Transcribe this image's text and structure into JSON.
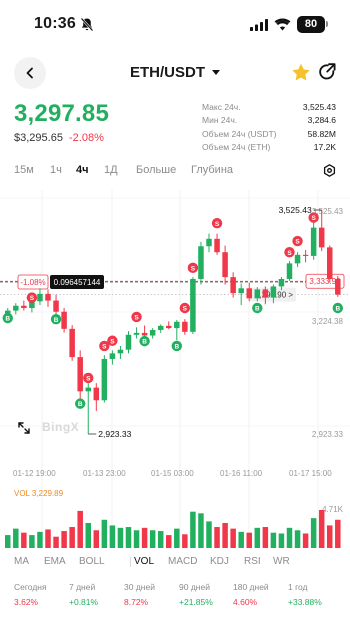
{
  "status_bar": {
    "time": "10:36",
    "battery": "80"
  },
  "header": {
    "pair": "ETH/USDT"
  },
  "ticker": {
    "last_price": "3,297.85",
    "fiat_price": "$3,295.65",
    "change_pct": "-2.08%",
    "stats": [
      {
        "label": "Макс 24ч.",
        "value": "3,525.43"
      },
      {
        "label": "Мин 24ч.",
        "value": "3,284.6"
      },
      {
        "label": "Объем 24ч (USDT)",
        "value": "58.82M"
      },
      {
        "label": "Объем 24ч (ETH)",
        "value": "17.2K"
      }
    ]
  },
  "timeframe_tabs": [
    "15м",
    "1ч",
    "4ч",
    "1Д",
    "Больше",
    "Глубина"
  ],
  "timeframe_selected": "4ч",
  "chart": {
    "watermark": "BingX",
    "high_marker": "3,525.43",
    "low_marker": "2,923.33",
    "axis_right_top": "3,525.43",
    "axis_right_mid": "3,224.38",
    "axis_right_bottom": "2,923.33",
    "last_price_tag": "3,333.93",
    "crosshair_pct": "-1.08%",
    "crosshair_value": "0.096457144",
    "mark_price_label": "3,297.90",
    "vol_label": "VOL 3,229.89",
    "vol_axis": "4.71K",
    "buy_badge": "B",
    "sell_badge": "S"
  },
  "chart_data": {
    "type": "candlestick",
    "x_ticks": [
      "01-12 19:00",
      "01-13 23:00",
      "01-15 03:00",
      "01-16 11:00",
      "01-17 15:00"
    ],
    "price_range": [
      2923.33,
      3525.43
    ],
    "price_ticks": [
      3525.43,
      3224.38,
      2923.33
    ],
    "candles": [
      [
        3245,
        3262,
        3232,
        3255
      ],
      [
        3255,
        3275,
        3245,
        3268
      ],
      [
        3268,
        3282,
        3255,
        3262
      ],
      [
        3262,
        3285,
        3250,
        3280
      ],
      [
        3280,
        3315,
        3270,
        3300
      ],
      [
        3300,
        3312,
        3265,
        3282
      ],
      [
        3282,
        3298,
        3240,
        3252
      ],
      [
        3252,
        3262,
        3196,
        3206
      ],
      [
        3206,
        3216,
        3120,
        3130
      ],
      [
        3130,
        3148,
        3012,
        3038
      ],
      [
        3038,
        3060,
        2923.33,
        3048
      ],
      [
        3048,
        3060,
        2985,
        3014
      ],
      [
        3014,
        3135,
        3008,
        3125
      ],
      [
        3125,
        3148,
        3110,
        3140
      ],
      [
        3140,
        3160,
        3125,
        3150
      ],
      [
        3150,
        3200,
        3140,
        3190
      ],
      [
        3190,
        3210,
        3180,
        3195
      ],
      [
        3195,
        3215,
        3182,
        3188
      ],
      [
        3188,
        3208,
        3180,
        3203
      ],
      [
        3203,
        3218,
        3195,
        3214
      ],
      [
        3214,
        3226,
        3205,
        3208
      ],
      [
        3208,
        3230,
        3175,
        3225
      ],
      [
        3225,
        3232,
        3190,
        3198
      ],
      [
        3198,
        3345,
        3192,
        3340
      ],
      [
        3340,
        3440,
        3325,
        3428
      ],
      [
        3428,
        3462,
        3412,
        3448
      ],
      [
        3448,
        3462,
        3405,
        3412
      ],
      [
        3412,
        3430,
        3325,
        3345
      ],
      [
        3345,
        3358,
        3290,
        3302
      ],
      [
        3302,
        3328,
        3270,
        3315
      ],
      [
        3315,
        3330,
        3280,
        3288
      ],
      [
        3288,
        3318,
        3280,
        3312
      ],
      [
        3312,
        3320,
        3272,
        3290
      ],
      [
        3290,
        3325,
        3275,
        3320
      ],
      [
        3320,
        3345,
        3310,
        3340
      ],
      [
        3340,
        3388,
        3335,
        3382
      ],
      [
        3382,
        3412,
        3372,
        3405
      ],
      [
        3405,
        3418,
        3385,
        3402
      ],
      [
        3402,
        3492,
        3392,
        3478
      ],
      [
        3478,
        3525.43,
        3415,
        3425
      ],
      [
        3425,
        3430,
        3330,
        3340
      ],
      [
        3340,
        3348,
        3292,
        3298
      ]
    ],
    "volume": [
      1.6,
      2.4,
      1.9,
      1.6,
      2.0,
      2.3,
      1.4,
      2.1,
      2.6,
      4.6,
      3.1,
      2.2,
      3.5,
      2.8,
      2.5,
      2.6,
      2.2,
      2.5,
      2.2,
      2.1,
      1.6,
      2.4,
      1.7,
      4.5,
      4.3,
      3.3,
      2.6,
      3.1,
      2.4,
      2.0,
      1.9,
      2.5,
      2.6,
      1.9,
      1.8,
      2.5,
      2.2,
      1.8,
      3.7,
      4.71,
      2.8,
      3.5
    ],
    "signals": [
      {
        "i": 0,
        "side": "B",
        "price": 3235
      },
      {
        "i": 3,
        "side": "S",
        "price": 3290
      },
      {
        "i": 6,
        "side": "B",
        "price": 3232
      },
      {
        "i": 9,
        "side": "B",
        "price": 3005
      },
      {
        "i": 10,
        "side": "S",
        "price": 3074
      },
      {
        "i": 12,
        "side": "S",
        "price": 3160
      },
      {
        "i": 13,
        "side": "S",
        "price": 3174
      },
      {
        "i": 16,
        "side": "S",
        "price": 3238
      },
      {
        "i": 17,
        "side": "B",
        "price": 3173
      },
      {
        "i": 21,
        "side": "B",
        "price": 3160
      },
      {
        "i": 22,
        "side": "S",
        "price": 3262
      },
      {
        "i": 23,
        "side": "S",
        "price": 3370
      },
      {
        "i": 26,
        "side": "S",
        "price": 3490
      },
      {
        "i": 31,
        "side": "B",
        "price": 3262
      },
      {
        "i": 35,
        "side": "S",
        "price": 3412
      },
      {
        "i": 36,
        "side": "S",
        "price": 3442
      },
      {
        "i": 38,
        "side": "S",
        "price": 3505
      },
      {
        "i": 41,
        "side": "B",
        "price": 3262
      }
    ],
    "last_price": 3333.93,
    "mark_price": 3297.9
  },
  "indicators": [
    "MA",
    "EMA",
    "BOLL",
    "VOL",
    "MACD",
    "KDJ",
    "RSI",
    "WR"
  ],
  "indicator_selected": "VOL",
  "performance": [
    {
      "label": "Сегодня",
      "value": "3.62%",
      "dir": "neg"
    },
    {
      "label": "7 дней",
      "value": "+0.81%",
      "dir": "pos"
    },
    {
      "label": "30 дней",
      "value": "8.72%",
      "dir": "neg"
    },
    {
      "label": "90 дней",
      "value": "+21.85%",
      "dir": "pos"
    },
    {
      "label": "180 дней",
      "value": "4.60%",
      "dir": "neg"
    },
    {
      "label": "1 год",
      "value": "+33.88%",
      "dir": "pos"
    }
  ],
  "colors": {
    "up": "#22b060",
    "down": "#f0384a",
    "star": "#f5c22b",
    "vol_text": "#f08a24"
  }
}
